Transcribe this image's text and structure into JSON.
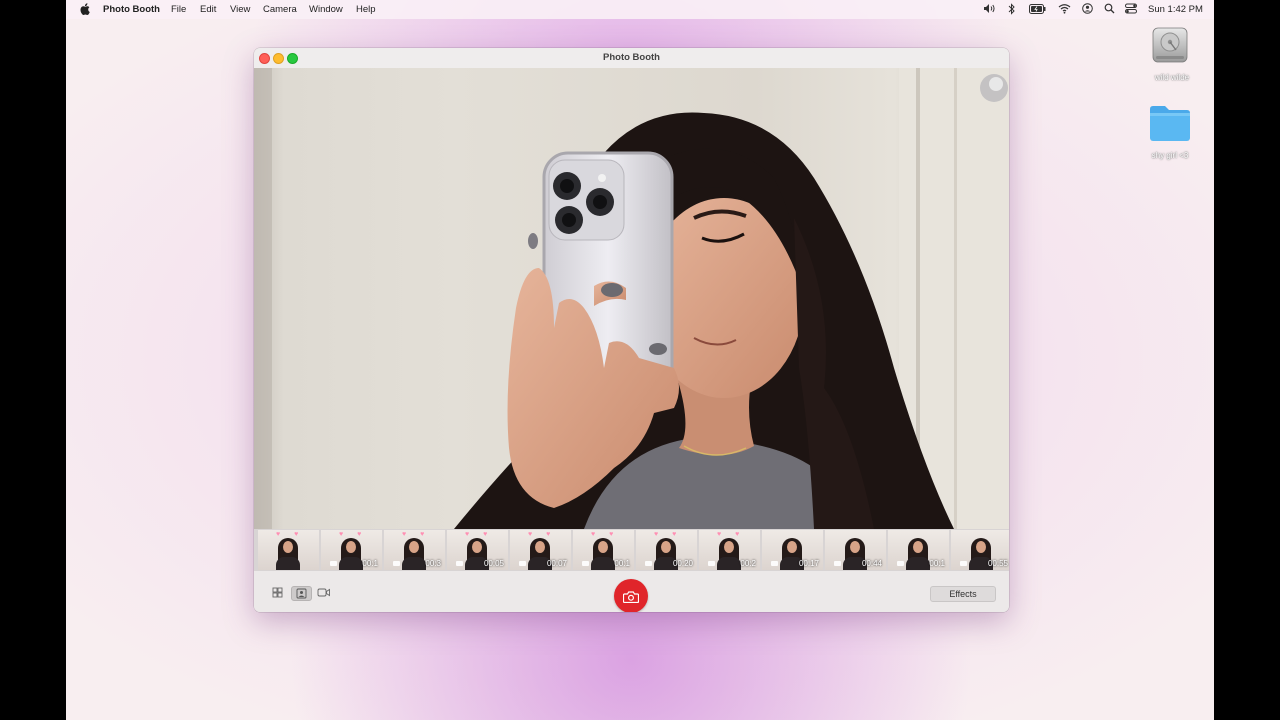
{
  "menubar": {
    "app_name": "Photo Booth",
    "items": [
      {
        "label": "File"
      },
      {
        "label": "Edit"
      },
      {
        "label": "View"
      },
      {
        "label": "Camera"
      },
      {
        "label": "Window"
      },
      {
        "label": "Help"
      }
    ],
    "clock": "Sun 1:42 PM",
    "status_icons": [
      "volume-icon",
      "bluetooth-icon",
      "battery-icon",
      "wifi-icon",
      "user-icon",
      "spotlight-search-icon",
      "control-center-icon"
    ]
  },
  "desktop": {
    "icons": [
      {
        "label": "wild wilde",
        "kind": "drive-icon"
      },
      {
        "label": "shy girl <3",
        "kind": "folder-icon"
      }
    ]
  },
  "window": {
    "title": "Photo Booth",
    "traffic_lights": {
      "close": "#ff5f57",
      "minimize": "#febc2e",
      "zoom": "#28c840"
    }
  },
  "filmstrip": {
    "thumbnails": [
      {
        "duration": "",
        "hearts": "♥ ♥"
      },
      {
        "duration": "00:1",
        "hearts": "♥ ♥"
      },
      {
        "duration": "00:3",
        "hearts": "♥ ♥"
      },
      {
        "duration": "00:05",
        "hearts": "♥ ♥"
      },
      {
        "duration": "00:07",
        "hearts": "♥ ♥"
      },
      {
        "duration": "00:1",
        "hearts": "♥ ♥"
      },
      {
        "duration": "00:20",
        "hearts": "♥ ♥"
      },
      {
        "duration": "00:2",
        "hearts": "♥ ♥"
      },
      {
        "duration": "00:17",
        "hearts": ""
      },
      {
        "duration": "00:44",
        "hearts": ""
      },
      {
        "duration": "00:1",
        "hearts": ""
      },
      {
        "duration": "00:55",
        "hearts": ""
      }
    ]
  },
  "toolbar": {
    "modes": [
      {
        "name": "grid-mode-icon",
        "selected": false
      },
      {
        "name": "single-photo-mode-icon",
        "selected": true
      },
      {
        "name": "video-mode-icon",
        "selected": false
      }
    ],
    "effects_label": "Effects"
  },
  "colors": {
    "accent": "#e0252a",
    "desktop_pink": "#d896e0",
    "folder_blue": "#5ab8f2"
  }
}
